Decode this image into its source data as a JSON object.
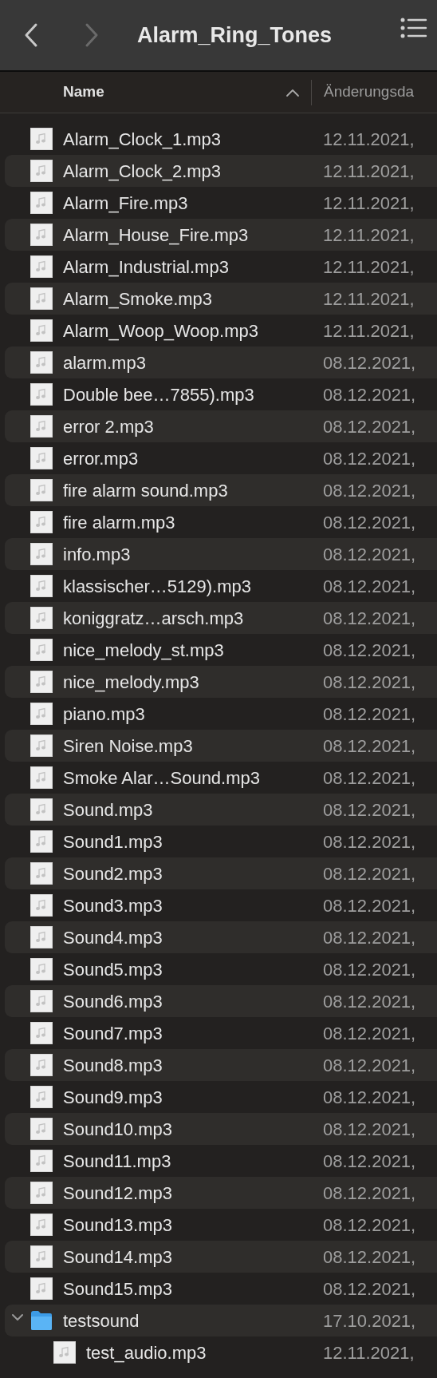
{
  "window": {
    "title": "Alarm_Ring_Tones"
  },
  "toolbar": {
    "back": {
      "disabled": false
    },
    "forward": {
      "disabled": true
    }
  },
  "columns": [
    {
      "label": "Name",
      "sort_ascending": true
    },
    {
      "label": "Änderungsda"
    }
  ],
  "files": [
    {
      "name": "Alarm_Clock_1.mp3",
      "kind": "audio",
      "modified": "12.11.2021,"
    },
    {
      "name": "Alarm_Clock_2.mp3",
      "kind": "audio",
      "modified": "12.11.2021,"
    },
    {
      "name": "Alarm_Fire.mp3",
      "kind": "audio",
      "modified": "12.11.2021,"
    },
    {
      "name": "Alarm_House_Fire.mp3",
      "kind": "audio",
      "modified": "12.11.2021,"
    },
    {
      "name": "Alarm_Industrial.mp3",
      "kind": "audio",
      "modified": "12.11.2021,"
    },
    {
      "name": "Alarm_Smoke.mp3",
      "kind": "audio",
      "modified": "12.11.2021,"
    },
    {
      "name": "Alarm_Woop_Woop.mp3",
      "kind": "audio",
      "modified": "12.11.2021,"
    },
    {
      "name": "alarm.mp3",
      "kind": "audio",
      "modified": "08.12.2021,"
    },
    {
      "name": "Double bee…7855).mp3",
      "kind": "audio",
      "modified": "08.12.2021,"
    },
    {
      "name": "error 2.mp3",
      "kind": "audio",
      "modified": "08.12.2021,"
    },
    {
      "name": "error.mp3",
      "kind": "audio",
      "modified": "08.12.2021,"
    },
    {
      "name": "fire alarm sound.mp3",
      "kind": "audio",
      "modified": "08.12.2021,"
    },
    {
      "name": "fire alarm.mp3",
      "kind": "audio",
      "modified": "08.12.2021,"
    },
    {
      "name": "info.mp3",
      "kind": "audio",
      "modified": "08.12.2021,"
    },
    {
      "name": "klassischer…5129).mp3",
      "kind": "audio",
      "modified": "08.12.2021,"
    },
    {
      "name": "koniggratz…arsch.mp3",
      "kind": "audio",
      "modified": "08.12.2021,"
    },
    {
      "name": "nice_melody_st.mp3",
      "kind": "audio",
      "modified": "08.12.2021,"
    },
    {
      "name": "nice_melody.mp3",
      "kind": "audio",
      "modified": "08.12.2021,"
    },
    {
      "name": "piano.mp3",
      "kind": "audio",
      "modified": "08.12.2021,"
    },
    {
      "name": "Siren Noise.mp3",
      "kind": "audio",
      "modified": "08.12.2021,"
    },
    {
      "name": "Smoke Alar…Sound.mp3",
      "kind": "audio",
      "modified": "08.12.2021,"
    },
    {
      "name": "Sound.mp3",
      "kind": "audio",
      "modified": "08.12.2021,"
    },
    {
      "name": "Sound1.mp3",
      "kind": "audio",
      "modified": "08.12.2021,"
    },
    {
      "name": "Sound2.mp3",
      "kind": "audio",
      "modified": "08.12.2021,"
    },
    {
      "name": "Sound3.mp3",
      "kind": "audio",
      "modified": "08.12.2021,"
    },
    {
      "name": "Sound4.mp3",
      "kind": "audio",
      "modified": "08.12.2021,"
    },
    {
      "name": "Sound5.mp3",
      "kind": "audio",
      "modified": "08.12.2021,"
    },
    {
      "name": "Sound6.mp3",
      "kind": "audio",
      "modified": "08.12.2021,"
    },
    {
      "name": "Sound7.mp3",
      "kind": "audio",
      "modified": "08.12.2021,"
    },
    {
      "name": "Sound8.mp3",
      "kind": "audio",
      "modified": "08.12.2021,"
    },
    {
      "name": "Sound9.mp3",
      "kind": "audio",
      "modified": "08.12.2021,"
    },
    {
      "name": "Sound10.mp3",
      "kind": "audio",
      "modified": "08.12.2021,"
    },
    {
      "name": "Sound11.mp3",
      "kind": "audio",
      "modified": "08.12.2021,"
    },
    {
      "name": "Sound12.mp3",
      "kind": "audio",
      "modified": "08.12.2021,"
    },
    {
      "name": "Sound13.mp3",
      "kind": "audio",
      "modified": "08.12.2021,"
    },
    {
      "name": "Sound14.mp3",
      "kind": "audio",
      "modified": "08.12.2021,"
    },
    {
      "name": "Sound15.mp3",
      "kind": "audio",
      "modified": "08.12.2021,"
    },
    {
      "name": "testsound",
      "kind": "folder",
      "expanded": true,
      "modified": "17.10.2021,",
      "children": [
        {
          "name": "test_audio.mp3",
          "kind": "audio",
          "modified": "12.11.2021,"
        }
      ]
    }
  ]
}
